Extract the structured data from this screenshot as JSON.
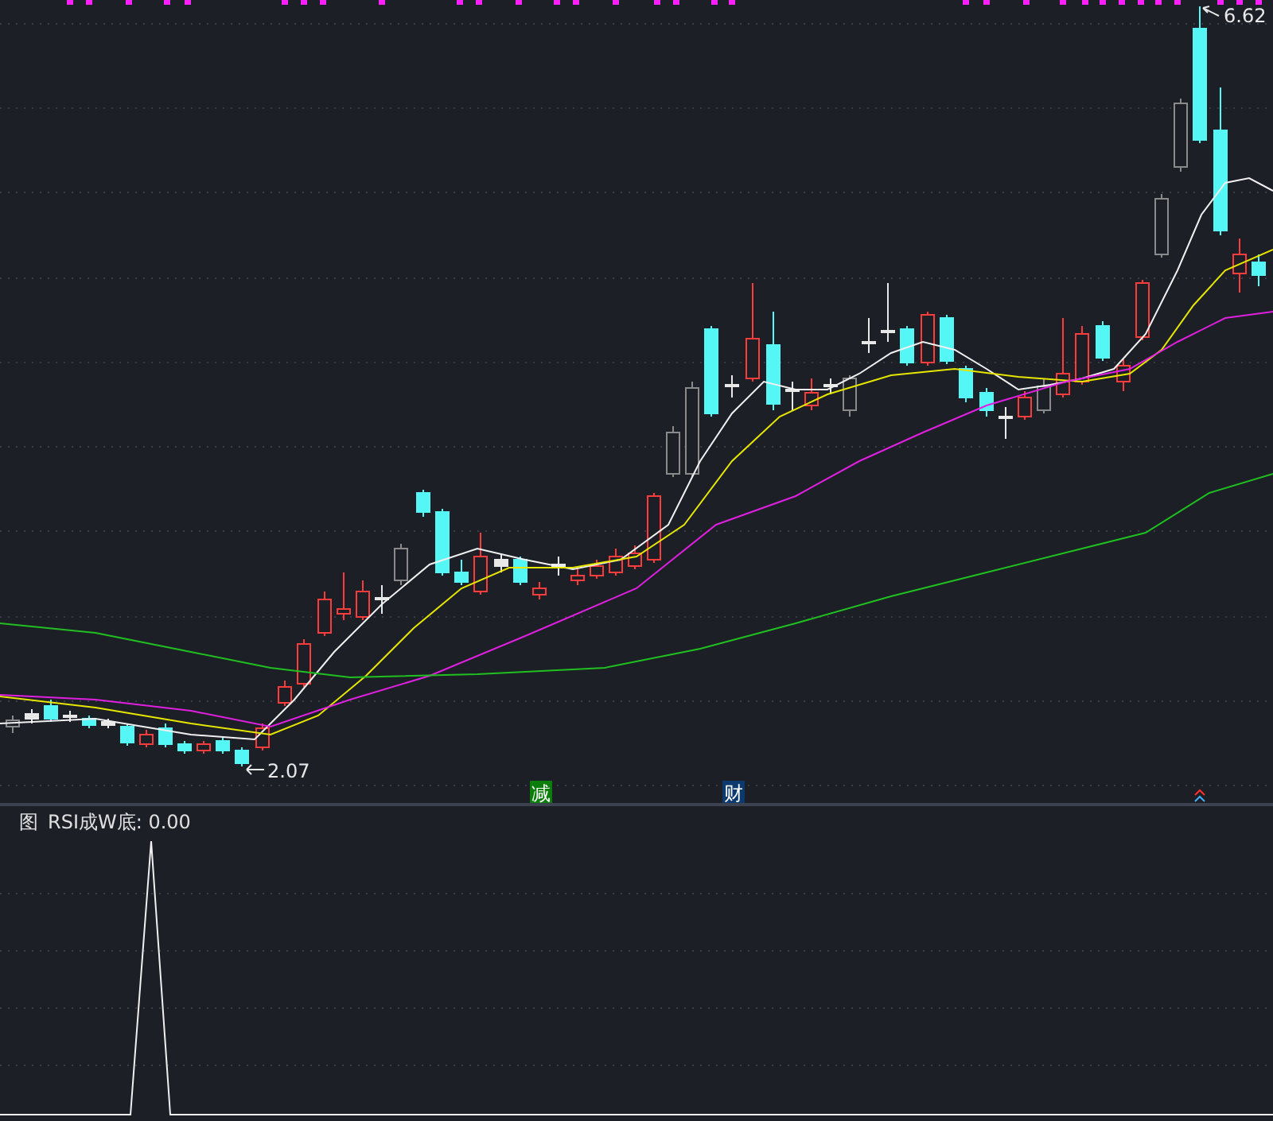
{
  "main_chart": {
    "high_label": "6.62",
    "low_label": "2.07",
    "signals": [
      {
        "text": "减",
        "color": "#0a7d0a"
      },
      {
        "text": "财",
        "color": "#0c3a6e"
      }
    ]
  },
  "sub_chart": {
    "title": "图",
    "indicator": "RSI成W底: 0.00"
  }
}
